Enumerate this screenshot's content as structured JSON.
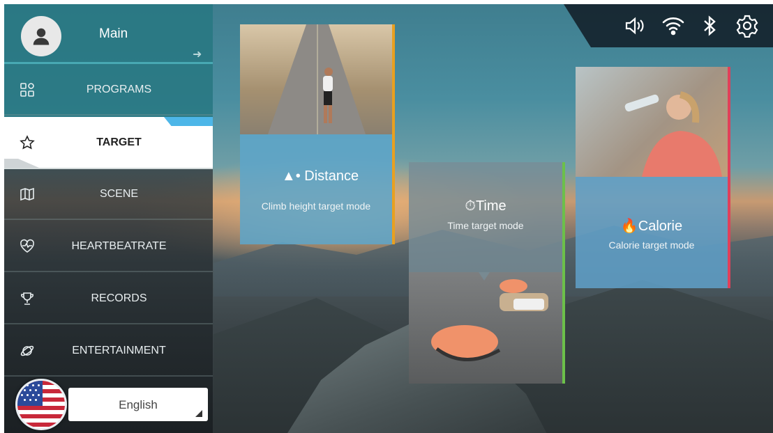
{
  "sidebar": {
    "main_label": "Main",
    "items": [
      {
        "label": "PROGRAMS",
        "icon": "grid-icon"
      },
      {
        "label": "TARGET",
        "icon": "star-icon"
      },
      {
        "label": "SCENE",
        "icon": "map-icon"
      },
      {
        "label": "HEARTBEATRATE",
        "icon": "heart-icon"
      },
      {
        "label": "RECORDS",
        "icon": "trophy-icon"
      },
      {
        "label": "ENTERTAINMENT",
        "icon": "planet-icon"
      }
    ],
    "active_item": "TARGET"
  },
  "language": {
    "selected": "English",
    "flag": "us-flag"
  },
  "status_bar": {
    "icons": [
      "volume-icon",
      "wifi-icon",
      "bluetooth-icon",
      "settings-icon"
    ]
  },
  "cards": [
    {
      "title": "Distance",
      "subtitle": "Climb height target mode",
      "icon": "distance-icon",
      "accent": "#e8a020"
    },
    {
      "title": "Time",
      "subtitle": "Time target mode",
      "icon": "timer-icon",
      "accent": "#6cc04a"
    },
    {
      "title": "Calorie",
      "subtitle": "Calorie target mode",
      "icon": "flame-icon",
      "accent": "#e0405a"
    }
  ],
  "colors": {
    "active_highlight": "#4db6e8",
    "sidebar_top": "#2a8a96"
  }
}
